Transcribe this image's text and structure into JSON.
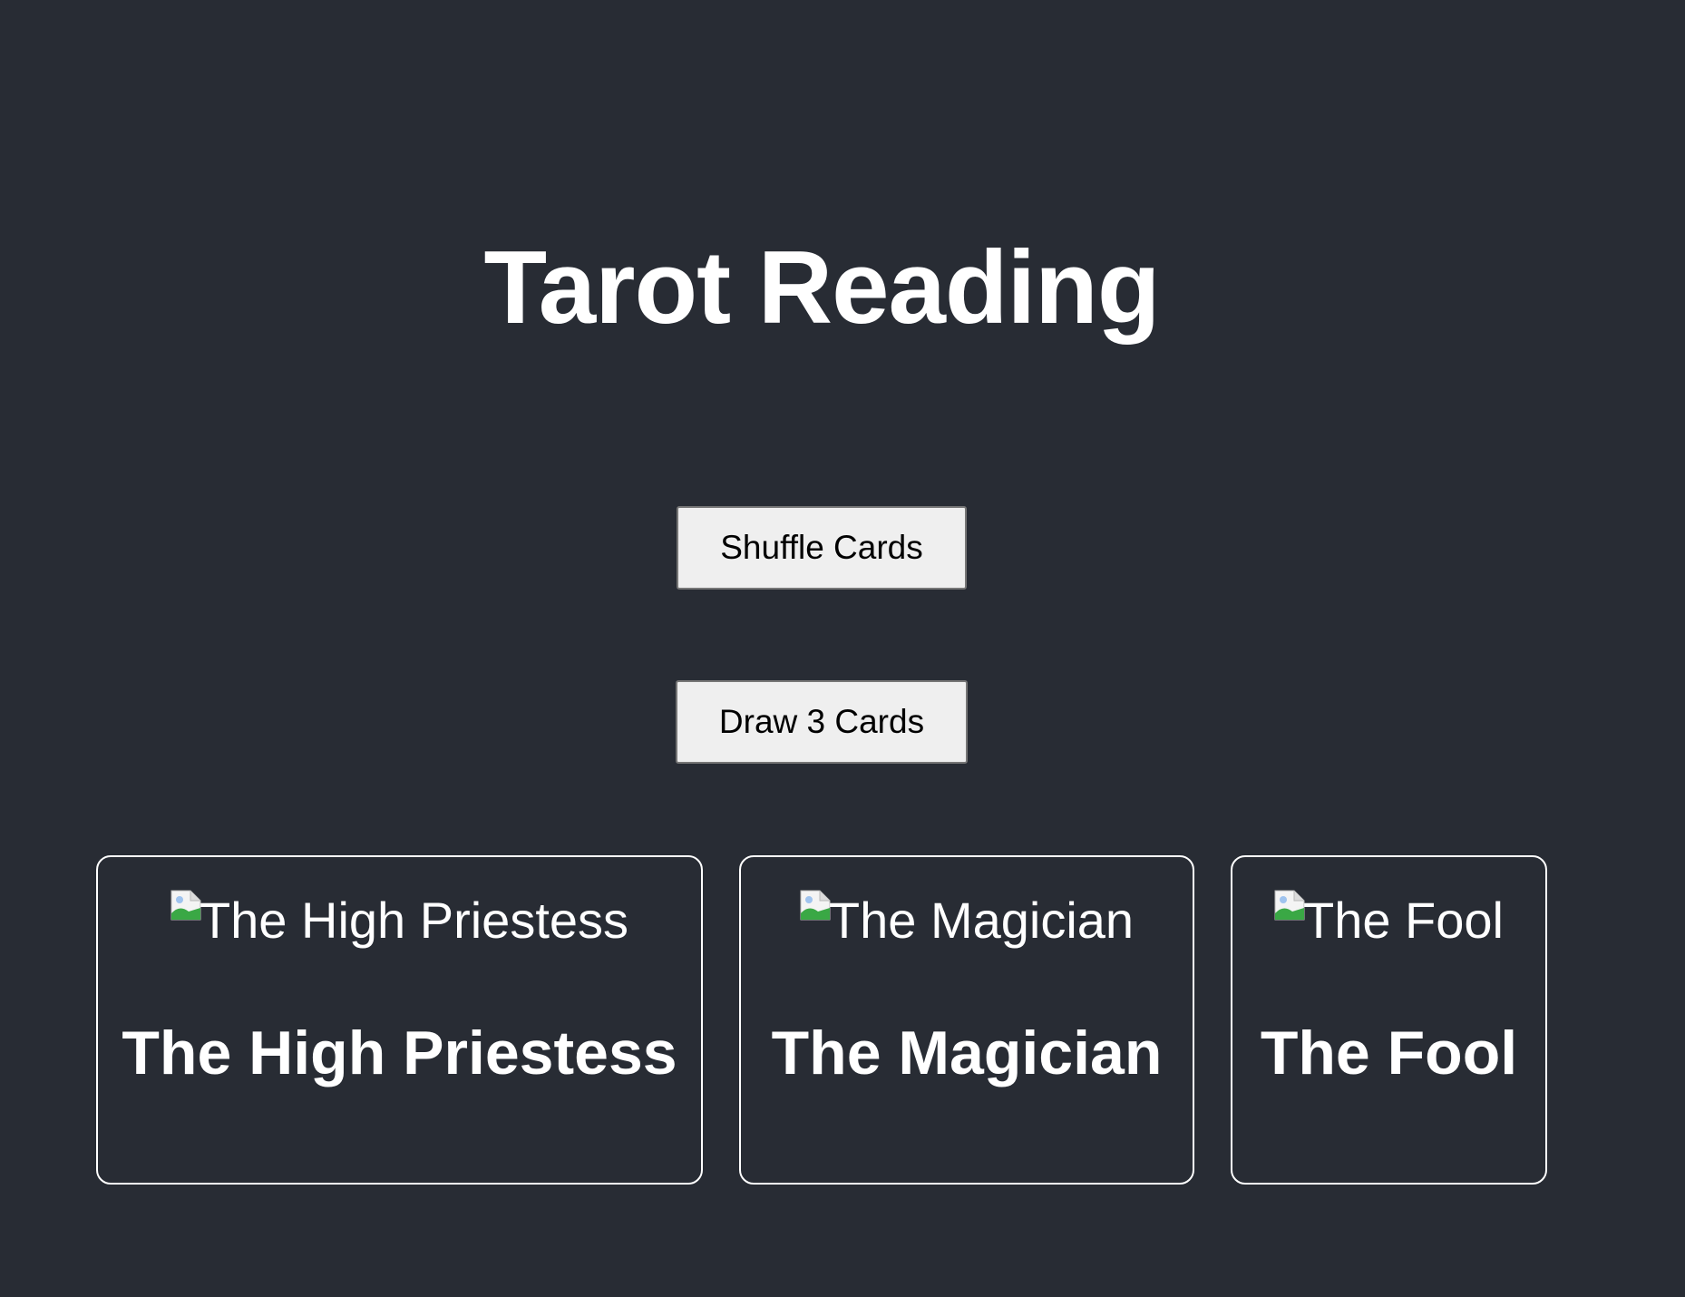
{
  "header": {
    "title": "Tarot Reading"
  },
  "controls": {
    "shuffle_label": "Shuffle Cards",
    "draw_label": "Draw 3 Cards"
  },
  "cards": [
    {
      "image_alt": "The High Priestess",
      "name": "The High Priestess",
      "image_icon": "broken-image-icon"
    },
    {
      "image_alt": "The Magician",
      "name": "The Magician",
      "image_icon": "broken-image-icon"
    },
    {
      "image_alt": "The Fool",
      "name": "The Fool",
      "image_icon": "broken-image-icon"
    }
  ],
  "colors": {
    "background": "#282c34",
    "text": "#ffffff",
    "button_bg": "#efefef",
    "button_border": "#767676",
    "card_border": "#ffffff"
  }
}
